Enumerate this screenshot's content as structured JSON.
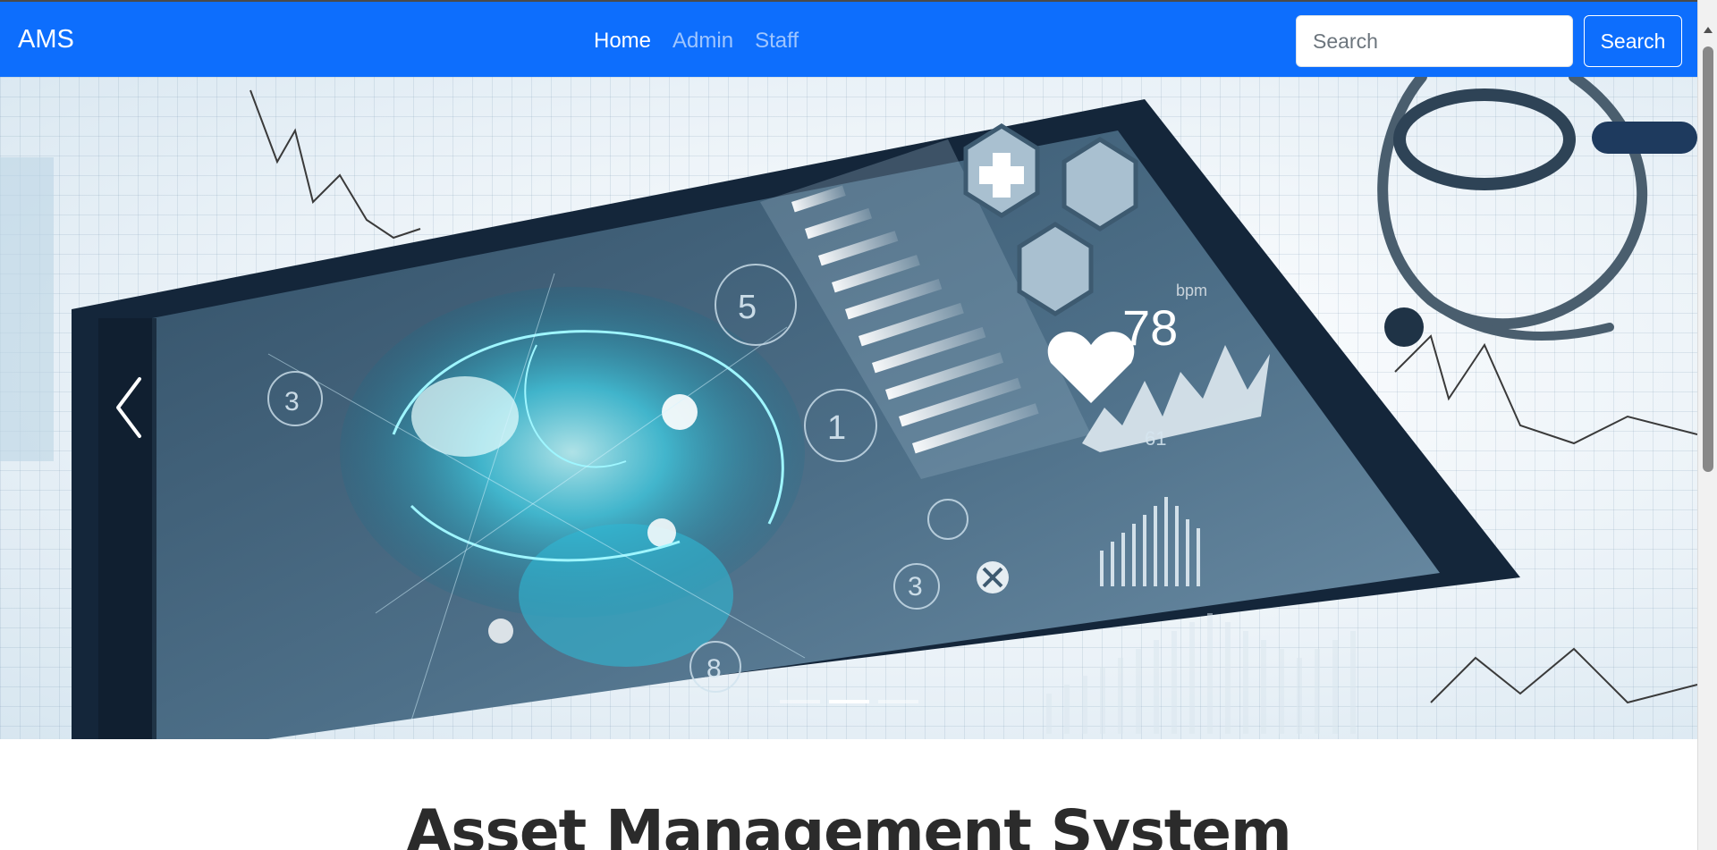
{
  "navbar": {
    "brand": "AMS",
    "links": [
      {
        "label": "Home",
        "active": true
      },
      {
        "label": "Admin",
        "active": false
      },
      {
        "label": "Staff",
        "active": false
      }
    ],
    "search": {
      "placeholder": "Search",
      "button_label": "Search"
    },
    "color": "#0d6efd"
  },
  "carousel": {
    "slide_count": 3,
    "active_slide": 2,
    "hud_readouts": [
      "78",
      "bpm",
      "61",
      "5",
      "3",
      "1",
      "3",
      "8"
    ],
    "prev_icon": "chevron-left-icon"
  },
  "main": {
    "title": "Asset Management System"
  }
}
